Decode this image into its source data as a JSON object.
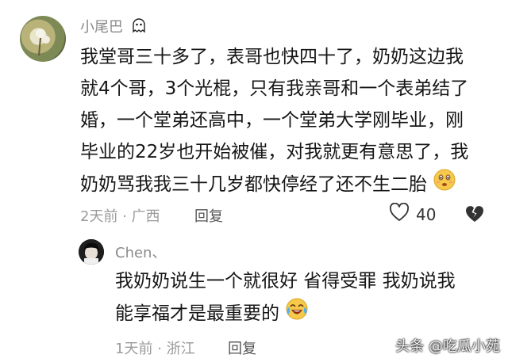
{
  "comments": [
    {
      "username": "小尾巴",
      "badge_icon": "ghost-icon",
      "lines": [
        "我堂哥三十多了，表哥也快四十了，奶奶这边我",
        "就4个哥，3个光棍，只有我亲哥和一个表弟结了",
        "婚，一个堂弟还高中，一个堂弟大学刚毕业，刚",
        "毕业的22岁也开始被催，对我就更有意思了，我",
        "奶奶骂我我三十几岁都快停经了还不生二胎"
      ],
      "end_emoji": "worried-face-emoji",
      "time": "2天前",
      "location": "广西",
      "reply_label": "回复",
      "likes": "40"
    },
    {
      "username": "Chen、",
      "lines": [
        "我奶奶说生一个就很好 省得受罪 我奶说我",
        "能享福才是最重要的"
      ],
      "end_emoji": "crying-laughing-emoji",
      "time": "1天前",
      "location": "浙江",
      "reply_label": "回复"
    }
  ],
  "watermark": "头条 @吃瓜小苑"
}
